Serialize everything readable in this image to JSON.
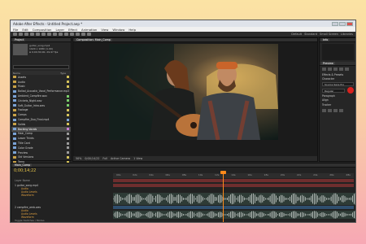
{
  "window": {
    "title": "Adobe After Effects - Untitled Project.aep *"
  },
  "menu": [
    "File",
    "Edit",
    "Composition",
    "Layer",
    "Effect",
    "Animation",
    "View",
    "Window",
    "Help"
  ],
  "toolbar": {
    "right": [
      "Default",
      "Standard",
      "Small Screen",
      "Libraries"
    ]
  },
  "project": {
    "tab": "Project",
    "meta": [
      "guitar_song.mp4",
      "1920 x 1080 (1.00)",
      "Δ 0;00;30;00, 29.97 fps"
    ],
    "columns": [
      "Name",
      "Type"
    ],
    "items": [
      {
        "name": "Assets",
        "type": "folder",
        "color": "#d6c35a"
      },
      {
        "name": "Audio",
        "type": "folder",
        "color": "#d6c35a"
      },
      {
        "name": "Music",
        "type": "folder",
        "color": "#d6c35a"
      },
      {
        "name": "Ballad_Acoustic_Vocal_Performance.mp3",
        "type": "file",
        "color": "#7ad06b"
      },
      {
        "name": "Ambient_Campfire.wav",
        "type": "file",
        "color": "#7ad06b"
      },
      {
        "name": "Crickets_Night.wav",
        "type": "file",
        "color": "#7ad06b"
      },
      {
        "name": "Soft_Guitar_Intro.wav",
        "type": "file",
        "color": "#7ad06b"
      },
      {
        "name": "Footage",
        "type": "folder",
        "color": "#d6c35a"
      },
      {
        "name": "Comps",
        "type": "folder",
        "color": "#d6c35a"
      },
      {
        "name": "Campfire_Duo_Final.mp4",
        "type": "file",
        "color": "#7aa3d6"
      },
      {
        "name": "Solids",
        "type": "folder",
        "color": "#d6c35a"
      },
      {
        "name": "Backing Vocals",
        "type": "file",
        "color": "#c77cd6"
      },
      {
        "name": "Main_Comp",
        "type": "comp",
        "color": "#9b9b9b"
      },
      {
        "name": "Lower Thirds",
        "type": "comp",
        "color": "#9b9b9b"
      },
      {
        "name": "Title Card",
        "type": "comp",
        "color": "#9b9b9b"
      },
      {
        "name": "Color Grade",
        "type": "comp",
        "color": "#9b9b9b"
      },
      {
        "name": "Preview",
        "type": "comp",
        "color": "#9b9b9b"
      },
      {
        "name": "Old Versions",
        "type": "folder",
        "color": "#d6c35a"
      },
      {
        "name": "Temp",
        "type": "folder",
        "color": "#d6c35a"
      },
      {
        "name": "Export",
        "type": "folder",
        "color": "#d6c35a"
      }
    ],
    "footer": "8 bpc"
  },
  "viewer": {
    "tab": "Composition: Main_Comp",
    "footer": [
      "50%",
      "0;00;14;22",
      "Full",
      "Active Camera",
      "1 View"
    ]
  },
  "right_panel": {
    "info_tab": "Info",
    "preview_tab": "Preview",
    "rows": [
      "Effects & Presets",
      "Character",
      "Paragraph",
      "Align",
      "Tracker"
    ],
    "dropdown": "Source Sans Pro",
    "dropdown2": "Regular",
    "accent": "#d9221e"
  },
  "timeline": {
    "tab": "Main_Comp",
    "time": "0;00;14;22",
    "ticks": [
      "00s",
      "02s",
      "04s",
      "06s",
      "08s",
      "10s",
      "12s",
      "14s",
      "16s",
      "18s",
      "20s",
      "22s",
      "24s",
      "26s",
      "28s"
    ],
    "layers": [
      {
        "name": "Layer Name",
        "kind": "header"
      },
      {
        "name": "1  guitar_song.mp4",
        "kind": "layer"
      },
      {
        "name": "Audio",
        "kind": "sub"
      },
      {
        "name": "Audio Levels",
        "kind": "sub"
      },
      {
        "name": "Waveform",
        "kind": "sub"
      },
      {
        "name": "2  campfire_amb.wav",
        "kind": "layer"
      },
      {
        "name": "Audio",
        "kind": "sub"
      },
      {
        "name": "Audio Levels",
        "kind": "sub"
      },
      {
        "name": "Waveform",
        "kind": "sub"
      }
    ],
    "footer": "Toggle Switches / Modes"
  }
}
